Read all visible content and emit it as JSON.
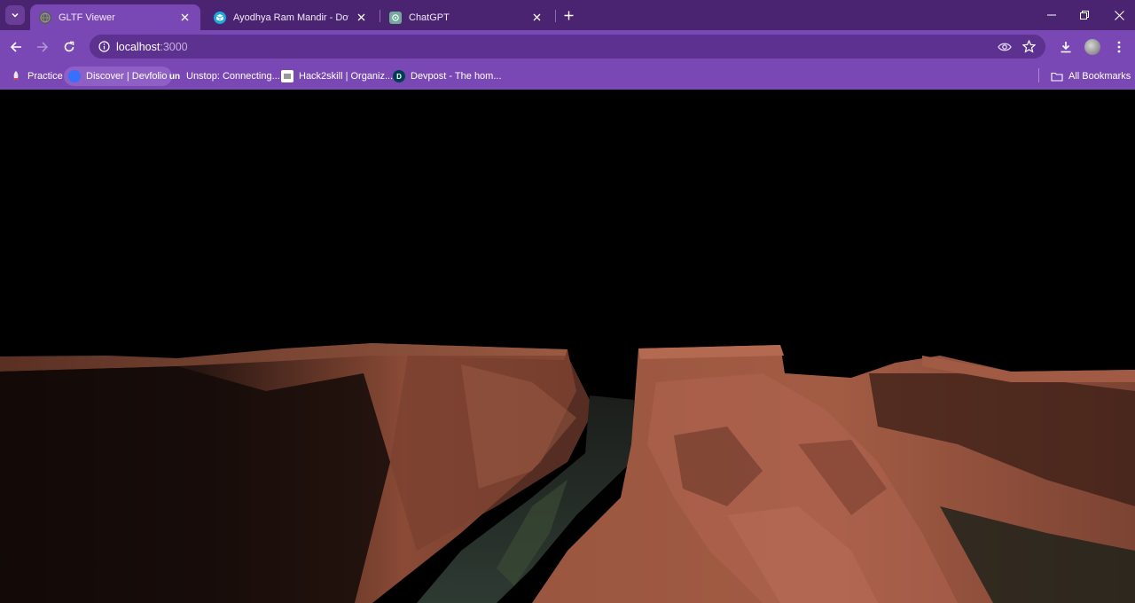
{
  "tabs": [
    {
      "title": "GLTF Viewer",
      "active": true,
      "icon": "globe-icon"
    },
    {
      "title": "Ayodhya Ram Mandir - Downlo",
      "active": false,
      "icon": "sketchfab-icon"
    },
    {
      "title": "ChatGPT",
      "active": false,
      "icon": "chatgpt-icon"
    }
  ],
  "address": {
    "host": "localhost",
    "port": ":3000"
  },
  "bookmarks": [
    {
      "label": "Practice",
      "icon": "practice-icon"
    },
    {
      "label": "Discover | Devfolio",
      "icon": "devfolio-icon"
    },
    {
      "label": "Unstop: Connecting...",
      "icon": "unstop-icon",
      "icon_text": "un"
    },
    {
      "label": "Hack2skill | Organiz...",
      "icon": "hack2skill-icon"
    },
    {
      "label": "Devpost - The hom...",
      "icon": "devpost-icon",
      "icon_text": "D"
    }
  ],
  "all_bookmarks": "All Bookmarks",
  "colors": {
    "tabstrip": "#4a2470",
    "toolbar": "#7a48b4",
    "omnibox": "#5c3190",
    "viewport": "#000000",
    "canyon_rock": "#8a4a35"
  },
  "scene": {
    "description_icon": "canyon-3d-model"
  }
}
